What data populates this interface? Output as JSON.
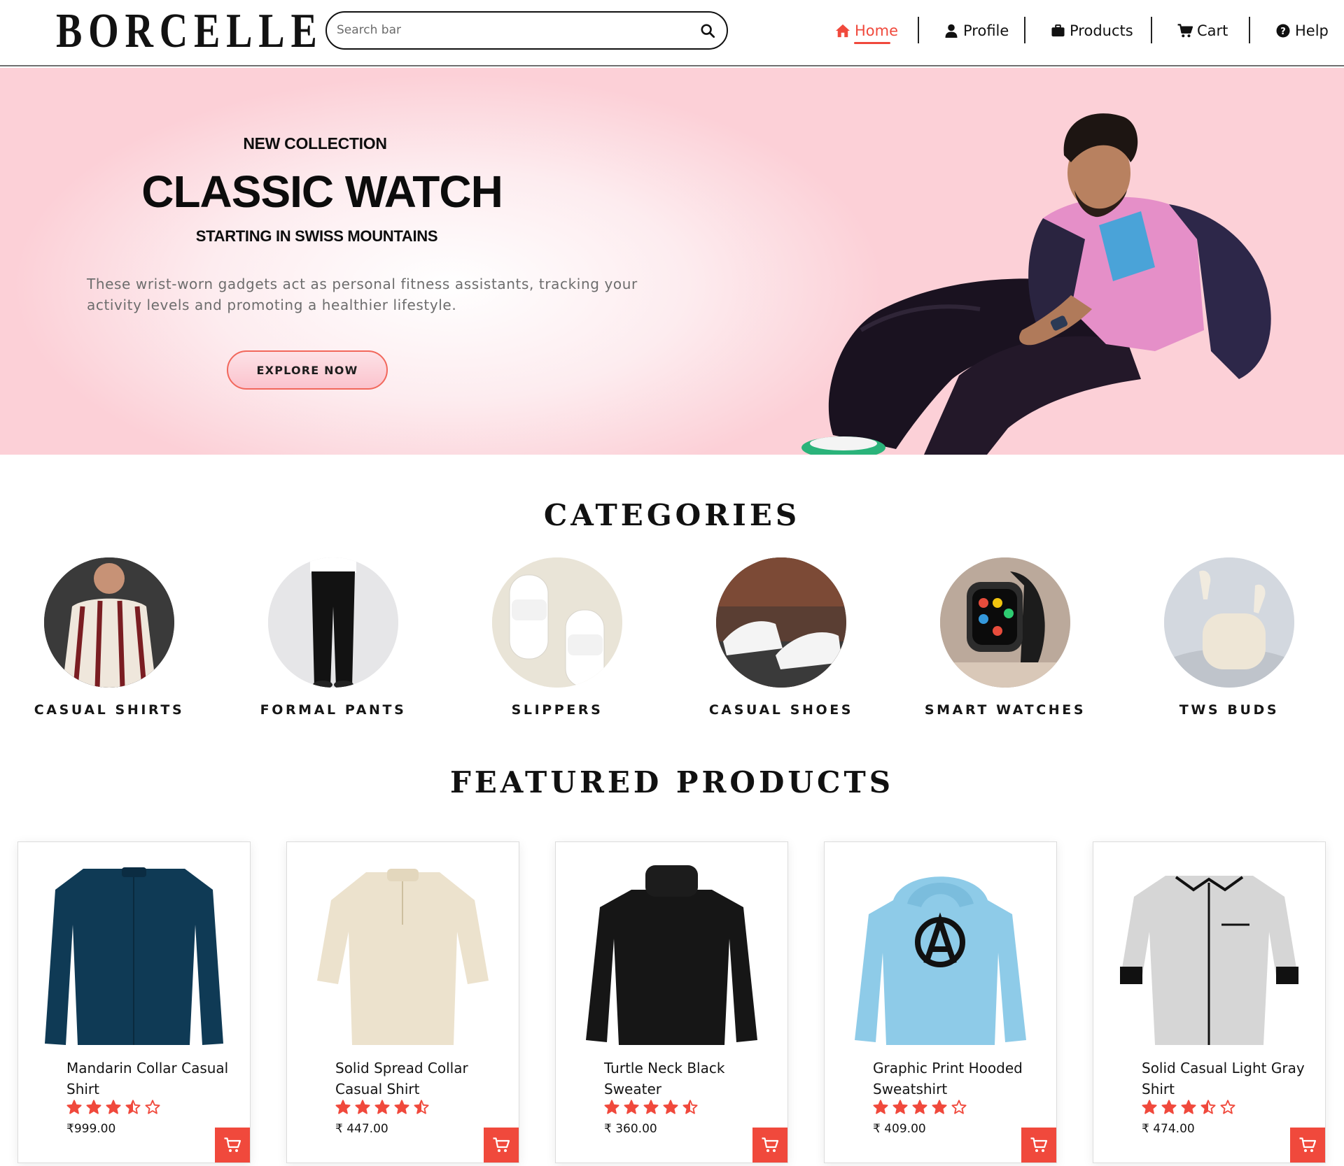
{
  "brand": {
    "logo": "BORCELLE"
  },
  "search": {
    "placeholder": "Search bar"
  },
  "nav": {
    "items": [
      {
        "label": "Home",
        "icon": "home-icon",
        "active": true
      },
      {
        "label": "Profile",
        "icon": "user-icon"
      },
      {
        "label": "Products",
        "icon": "briefcase-icon"
      },
      {
        "label": "Cart",
        "icon": "cart-icon"
      },
      {
        "label": "Help",
        "icon": "help-icon"
      }
    ],
    "active_color": "#f0493c"
  },
  "hero": {
    "eyebrow": "NEW COLLECTION",
    "title": "CLASSIC WATCH",
    "subtitle": "STARTING IN SWISS MOUNTAINS",
    "description": "These wrist-worn gadgets act as personal fitness assistants, tracking your activity levels and promoting a healthier lifestyle.",
    "cta": "EXPLORE NOW"
  },
  "categories": {
    "title": "CATEGORIES",
    "items": [
      {
        "label": "CASUAL SHIRTS"
      },
      {
        "label": "FORMAL PANTS"
      },
      {
        "label": "SLIPPERS"
      },
      {
        "label": "CASUAL SHOES"
      },
      {
        "label": "SMART WATCHES"
      },
      {
        "label": "TWS BUDS"
      }
    ]
  },
  "featured": {
    "title": "FEATURED PRODUCTS",
    "products": [
      {
        "name": "Mandarin Collar Casual Shirt",
        "rating": 3.5,
        "price": "₹999.00"
      },
      {
        "name": "Solid Spread Collar Casual Shirt",
        "rating": 4.5,
        "price": "₹ 447.00"
      },
      {
        "name": "Turtle Neck Black Sweater",
        "rating": 4.5,
        "price": "₹ 360.00"
      },
      {
        "name": "Graphic Print Hooded Sweatshirt",
        "rating": 4,
        "price": "₹ 409.00"
      },
      {
        "name": "Solid Casual Light Gray Shirt",
        "rating": 3.5,
        "price": "₹ 474.00"
      }
    ]
  },
  "colors": {
    "accent": "#f0493c",
    "hero_pink": "#fcd0d7"
  }
}
